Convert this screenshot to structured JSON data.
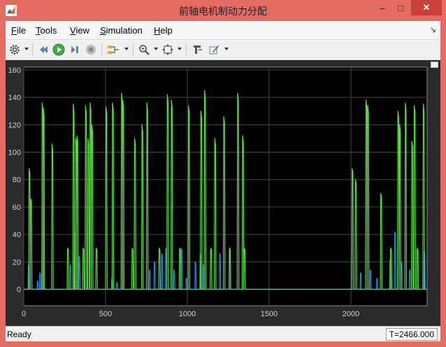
{
  "window": {
    "title": "前轴电机制动力分配",
    "minimize_glyph": "–",
    "maximize_glyph": "□",
    "close_glyph": "✕"
  },
  "menu": [
    {
      "mnemonic": "F",
      "rest": "ile"
    },
    {
      "mnemonic": "T",
      "rest": "ools"
    },
    {
      "mnemonic": "V",
      "rest": "iew"
    },
    {
      "mnemonic": "S",
      "rest": "imulation"
    },
    {
      "mnemonic": "H",
      "rest": "elp"
    }
  ],
  "toolbar": {
    "icons": [
      "gear-icon",
      "step-back-icon",
      "run-icon",
      "step-forward-icon",
      "stop-icon",
      "signal-config-icon",
      "zoom-icon",
      "fit-icon",
      "cursor-icon",
      "style-icon"
    ]
  },
  "status": {
    "text": "Ready",
    "time": "T=2466.000"
  },
  "colors": {
    "titlebar": "#e36b61",
    "plot_bg": "#000000",
    "green_series": "#55e03a",
    "blue_series": "#2a84d9"
  },
  "chart_data": {
    "type": "line",
    "title": "",
    "xlabel": "",
    "ylabel": "",
    "xlim": [
      0,
      2466
    ],
    "ylim": [
      -12,
      162
    ],
    "grid": true,
    "xticks": [
      "0",
      "500",
      "1000",
      "1500",
      "2000"
    ],
    "yticks": [
      "0",
      "20",
      "40",
      "60",
      "80",
      "100",
      "120",
      "140",
      "160"
    ],
    "series": [
      {
        "color": "#55e03a",
        "peaks": [
          [
            35,
            88
          ],
          [
            45,
            66
          ],
          [
            115,
            136
          ],
          [
            122,
            132
          ],
          [
            175,
            106
          ],
          [
            270,
            30
          ],
          [
            305,
            135
          ],
          [
            320,
            110
          ],
          [
            328,
            112
          ],
          [
            365,
            30
          ],
          [
            380,
            134
          ],
          [
            395,
            110
          ],
          [
            408,
            136
          ],
          [
            418,
            120
          ],
          [
            445,
            30
          ],
          [
            505,
            133
          ],
          [
            545,
            136
          ],
          [
            600,
            143
          ],
          [
            608,
            138
          ],
          [
            665,
            30
          ],
          [
            680,
            110
          ],
          [
            725,
            120
          ],
          [
            755,
            136
          ],
          [
            830,
            30
          ],
          [
            880,
            142
          ],
          [
            905,
            138
          ],
          [
            955,
            30
          ],
          [
            1010,
            134
          ],
          [
            1085,
            130
          ],
          [
            1108,
            145
          ],
          [
            1145,
            30
          ],
          [
            1170,
            110
          ],
          [
            1225,
            126
          ],
          [
            1260,
            30
          ],
          [
            1310,
            143
          ],
          [
            1340,
            112
          ],
          [
            1350,
            30
          ],
          [
            2010,
            88
          ],
          [
            2030,
            80
          ],
          [
            2095,
            138
          ],
          [
            2105,
            134
          ],
          [
            2185,
            70
          ],
          [
            2245,
            30
          ],
          [
            2290,
            130
          ],
          [
            2300,
            120
          ],
          [
            2335,
            136
          ],
          [
            2375,
            108
          ],
          [
            2390,
            134
          ],
          [
            2408,
            30
          ],
          [
            2445,
            135
          ]
        ]
      },
      {
        "color": "#2a84d9",
        "peaks": [
          [
            30,
            18
          ],
          [
            85,
            6
          ],
          [
            100,
            12
          ],
          [
            285,
            18
          ],
          [
            310,
            42
          ],
          [
            340,
            24
          ],
          [
            540,
            8
          ],
          [
            570,
            5
          ],
          [
            770,
            14
          ],
          [
            800,
            20
          ],
          [
            845,
            26
          ],
          [
            870,
            30
          ],
          [
            920,
            14
          ],
          [
            965,
            30
          ],
          [
            995,
            8
          ],
          [
            1050,
            20
          ],
          [
            1080,
            26
          ],
          [
            1100,
            18
          ],
          [
            1200,
            26
          ],
          [
            1260,
            30
          ],
          [
            2060,
            12
          ],
          [
            2120,
            14
          ],
          [
            2160,
            8
          ],
          [
            2240,
            22
          ],
          [
            2270,
            42
          ],
          [
            2310,
            20
          ],
          [
            2360,
            14
          ],
          [
            2450,
            28
          ]
        ]
      }
    ]
  }
}
